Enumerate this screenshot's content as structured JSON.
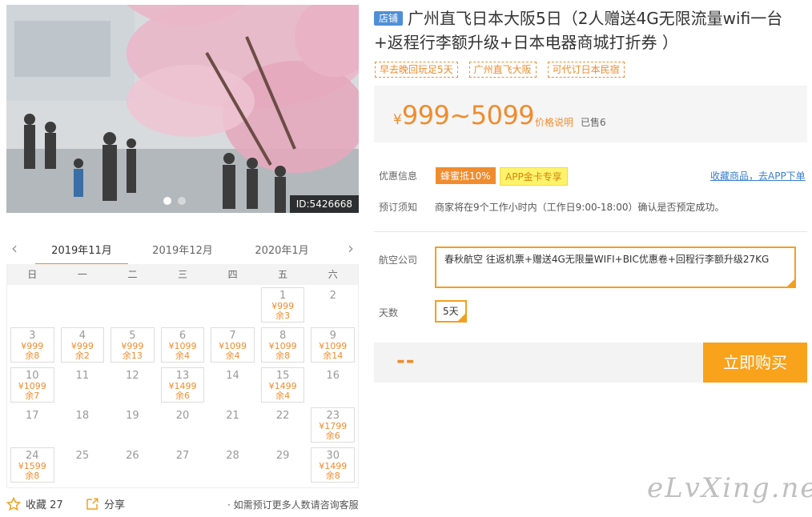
{
  "photo": {
    "id_label": "ID:5426668"
  },
  "calendar": {
    "prev": "‹",
    "next": "›",
    "months": [
      "2019年11月",
      "2019年12月",
      "2020年1月"
    ],
    "weekdays": [
      "日",
      "一",
      "二",
      "三",
      "四",
      "五",
      "六"
    ],
    "days": [
      {
        "d": ""
      },
      {
        "d": ""
      },
      {
        "d": ""
      },
      {
        "d": ""
      },
      {
        "d": ""
      },
      {
        "d": "1",
        "price": "¥999",
        "left": "余3"
      },
      {
        "d": "2"
      },
      {
        "d": "3",
        "price": "¥999",
        "left": "余8"
      },
      {
        "d": "4",
        "price": "¥999",
        "left": "余2"
      },
      {
        "d": "5",
        "price": "¥999",
        "left": "余13"
      },
      {
        "d": "6",
        "price": "¥1099",
        "left": "余4"
      },
      {
        "d": "7",
        "price": "¥1099",
        "left": "余4"
      },
      {
        "d": "8",
        "price": "¥1099",
        "left": "余8"
      },
      {
        "d": "9",
        "price": "¥1099",
        "left": "余14"
      },
      {
        "d": "10",
        "price": "¥1099",
        "left": "余7"
      },
      {
        "d": "11"
      },
      {
        "d": "12"
      },
      {
        "d": "13",
        "price": "¥1499",
        "left": "余6"
      },
      {
        "d": "14"
      },
      {
        "d": "15",
        "price": "¥1499",
        "left": "余4"
      },
      {
        "d": "16"
      },
      {
        "d": "17"
      },
      {
        "d": "18"
      },
      {
        "d": "19"
      },
      {
        "d": "20"
      },
      {
        "d": "21"
      },
      {
        "d": "22"
      },
      {
        "d": "23",
        "price": "¥1799",
        "left": "余6"
      },
      {
        "d": "24",
        "price": "¥1599",
        "left": "余8"
      },
      {
        "d": "25"
      },
      {
        "d": "26"
      },
      {
        "d": "27"
      },
      {
        "d": "28"
      },
      {
        "d": "29"
      },
      {
        "d": "30",
        "price": "¥1499",
        "left": "余8"
      }
    ]
  },
  "footer": {
    "fav_label": "收藏 27",
    "share_label": "分享",
    "consult": "· 如需预订更多人数请咨询客服"
  },
  "product": {
    "shop_tag": "店铺",
    "title": "广州直飞日本大阪5日（2人赠送4G无限流量wifi一台+返程行李额升级+日本电器商城打折券 ）",
    "tags": [
      "早去晚回玩足5天",
      "广州直飞大阪",
      "可代订日本民宿"
    ],
    "currency": "¥",
    "price_range": "999~5099",
    "price_note": "价格说明",
    "sold": "已售6"
  },
  "promo": {
    "label": "优惠信息",
    "badge1": "蜂蜜抵10%",
    "badge2": "APP金卡专享",
    "app_link": "收藏商品，去APP下单"
  },
  "booking": {
    "label": "预订须知",
    "text": "商家将在9个工作小时内（工作日9:00-18:00）确认是否预定成功。"
  },
  "options": {
    "airline_label": "航空公司",
    "airline_value": "春秋航空 往返机票+赠送4G无限量WIFI+BIC优惠卷+回程行李额升级27KG",
    "days_label": "天数",
    "days_value": "5天"
  },
  "buy": {
    "total": "--",
    "button": "立即购买"
  },
  "watermark": "eLvXing.net",
  "colors": {
    "accent": "#f08c2d",
    "button": "#f9a21b",
    "shop_tag": "#4f8fd6",
    "link": "#3a7fd0"
  }
}
